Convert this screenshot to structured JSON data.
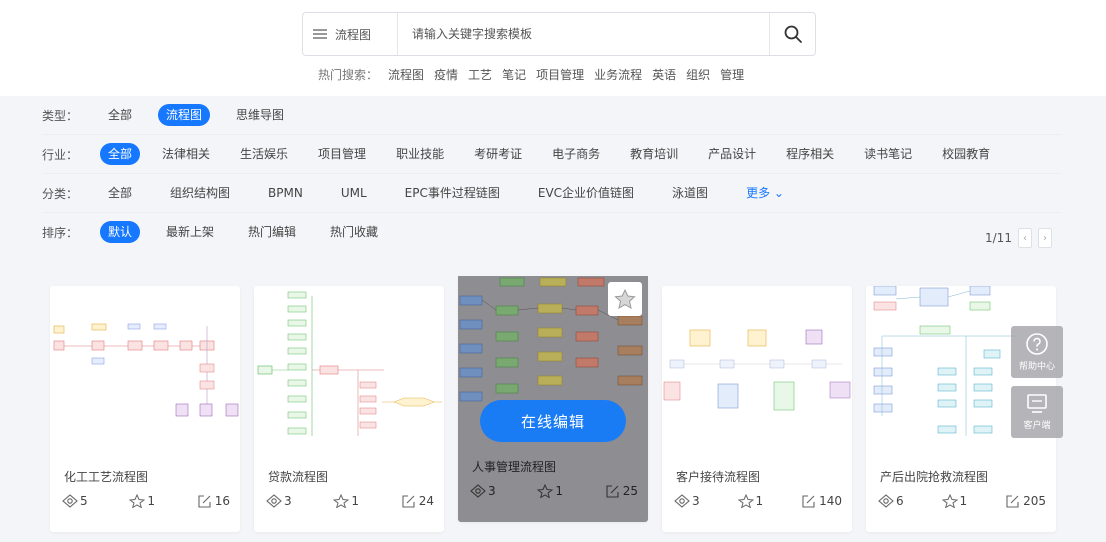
{
  "search": {
    "type_label": "流程图",
    "placeholder": "请输入关键字搜索模板"
  },
  "hot": {
    "label": "热门搜索：",
    "keywords": [
      "流程图",
      "疫情",
      "工艺",
      "笔记",
      "项目管理",
      "业务流程",
      "英语",
      "组织",
      "管理"
    ]
  },
  "filters": {
    "type": {
      "label": "类型：",
      "options": [
        "全部",
        "流程图",
        "思维导图"
      ],
      "selected": "流程图"
    },
    "industry": {
      "label": "行业：",
      "options": [
        "全部",
        "法律相关",
        "生活娱乐",
        "项目管理",
        "职业技能",
        "考研考证",
        "电子商务",
        "教育培训",
        "产品设计",
        "程序相关",
        "读书笔记",
        "校园教育"
      ],
      "selected": "全部"
    },
    "category": {
      "label": "分类：",
      "options": [
        "全部",
        "组织结构图",
        "BPMN",
        "UML",
        "EPC事件过程链图",
        "EVC企业价值链图",
        "泳道图"
      ],
      "more": "更多"
    },
    "sort": {
      "label": "排序：",
      "options": [
        "默认",
        "最新上架",
        "热门编辑",
        "热门收藏"
      ],
      "selected": "默认"
    }
  },
  "pager": {
    "text": "1/11"
  },
  "cards": [
    {
      "title": "化工工艺流程图",
      "views": "5",
      "likes": "1",
      "edits": "16"
    },
    {
      "title": "贷款流程图",
      "views": "3",
      "likes": "1",
      "edits": "24"
    },
    {
      "title": "人事管理流程图",
      "views": "3",
      "likes": "1",
      "edits": "25",
      "edit_label": "在线编辑"
    },
    {
      "title": "客户接待流程图",
      "views": "3",
      "likes": "1",
      "edits": "140"
    },
    {
      "title": "产后出院抢救流程图",
      "views": "6",
      "likes": "1",
      "edits": "205"
    }
  ],
  "side": {
    "help": "帮助中心",
    "client": "客户端"
  },
  "colors": {
    "accent": "#1677ff"
  }
}
